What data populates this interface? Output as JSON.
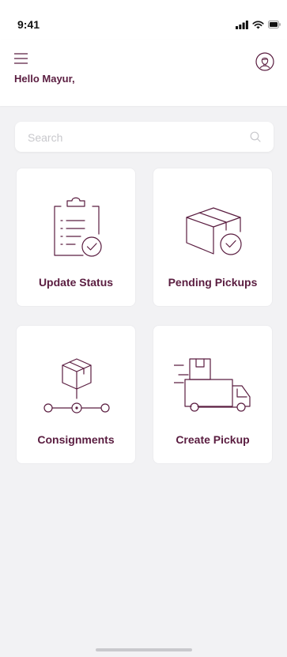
{
  "status_bar": {
    "time": "9:41"
  },
  "header": {
    "greeting": "Hello Mayur,"
  },
  "search": {
    "placeholder": "Search",
    "value": ""
  },
  "cards": [
    {
      "label": "Update Status",
      "icon": "clipboard-check-icon"
    },
    {
      "label": "Pending Pickups",
      "icon": "box-clock-icon"
    },
    {
      "label": "Consignments",
      "icon": "box-route-icon"
    },
    {
      "label": "Create Pickup",
      "icon": "delivery-truck-icon"
    }
  ],
  "colors": {
    "brand": "#5a1d40",
    "background": "#f2f2f4",
    "card": "#ffffff"
  }
}
